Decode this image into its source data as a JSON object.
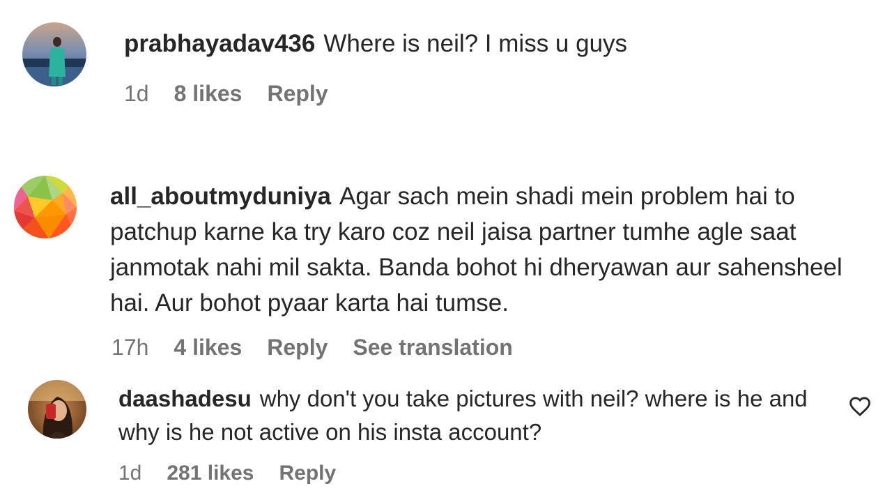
{
  "comments": [
    {
      "username": "prabhayadav436",
      "text": "Where is neil? I miss u guys",
      "time": "1d",
      "likes": "8 likes",
      "reply": "Reply"
    },
    {
      "username": "all_aboutmyduniya",
      "text": "Agar sach mein shadi mein problem hai to patchup karne ka try karo coz neil jaisa partner tumhe agle saat janmotak nahi mil sakta. Banda bohot hi dheryawan aur sahensheel hai. Aur bohot pyaar karta hai tumse.",
      "time": "17h",
      "likes": "4 likes",
      "reply": "Reply",
      "translate": "See translation"
    },
    {
      "username": "daashadesu",
      "text": "why don't you take pictures with neil? where is he and why is he not active on his insta account?",
      "time": "1d",
      "likes": "281 likes",
      "reply": "Reply",
      "icon": "heart-outline-icon"
    }
  ],
  "colors": {
    "text": "#262626",
    "secondary": "#737373",
    "background": "#ffffff"
  }
}
